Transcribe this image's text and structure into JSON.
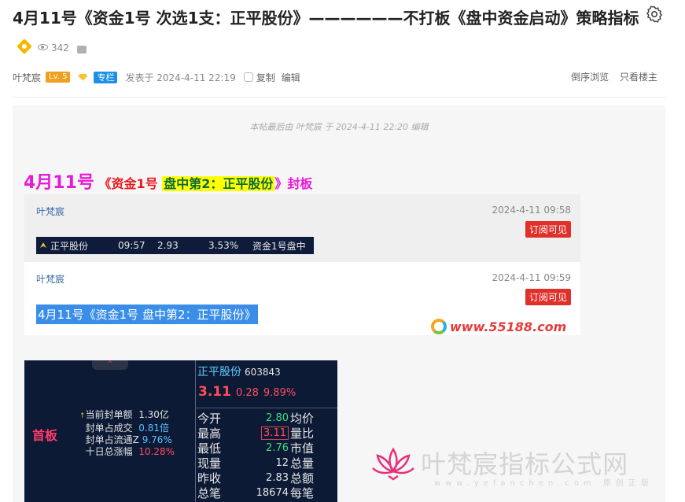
{
  "post": {
    "title": "4月11号《资金1号 次选1支：正平股份》——————不打板《盘中资金启动》策略指标",
    "views": "342"
  },
  "meta": {
    "author": "叶梵宸",
    "level": "Lv. 5",
    "column_tag": "专栏",
    "posted": "发表于 2024-4-11 22:19",
    "copy": "复制",
    "edit": "编辑",
    "reverse_view": "倒序浏览",
    "author_only": "只看楼主"
  },
  "body": {
    "last_edit": "本帖最后由 叶梵宸 于 2024-4-11 22:20 编辑",
    "headline": {
      "date": "4月11号",
      "fund": "《资金1号",
      "highlight": "盘中第2：正平股份",
      "suffix": "》封板"
    },
    "cards": [
      {
        "author": "叶梵宸",
        "time": "2024-4-11 09:58",
        "subscribe": "订阅可见",
        "stock_row": {
          "name": "正平股份",
          "time": "09:57",
          "price": "2.93",
          "pct": "3.53%",
          "signal": "资金1号盘中"
        }
      },
      {
        "author": "叶梵宸",
        "time": "2024-4-11 09:59",
        "subscribe": "订阅可见",
        "selected_text": "4月11号《资金1号  盘中第2：正平股份》"
      }
    ],
    "watermark_url": "www.55188.com"
  },
  "panel": {
    "notch": "^",
    "first_board": "首板",
    "fields": [
      {
        "label": "当前封单额",
        "value": "1.30亿",
        "color": "vw"
      },
      {
        "label": "封单占成交",
        "value": "0.81倍",
        "color": "vb"
      },
      {
        "label": "封单占流通Z",
        "value": "9.76%",
        "color": "vb"
      },
      {
        "label": "十日总涨幅",
        "value": "10.28%",
        "color": "vr"
      }
    ],
    "stock_name": "正平股份",
    "stock_code": "603843",
    "price": "3.11",
    "change": "0.28",
    "change_pct": "9.89%",
    "rows": [
      {
        "label": "今开",
        "value": "2.80",
        "label2": "均价"
      },
      {
        "label": "最高",
        "value": "3.11",
        "label2": "量比"
      },
      {
        "label": "最低",
        "value": "2.76",
        "label2": "市值"
      },
      {
        "label": "现量",
        "value": "12",
        "label2": "总量"
      },
      {
        "label": "昨收",
        "value": "2.83",
        "label2": "总额"
      },
      {
        "label": "总笔",
        "value": "18674",
        "label2": "每笔"
      }
    ]
  },
  "brand": {
    "name": "叶梵宸指标公式网",
    "url": "www.yefanchen.com 原创正版"
  },
  "colors": {
    "accent_blue": "#1e90e6",
    "subscribe_red": "#e0302a",
    "headline_magenta": "#e81ad7"
  }
}
